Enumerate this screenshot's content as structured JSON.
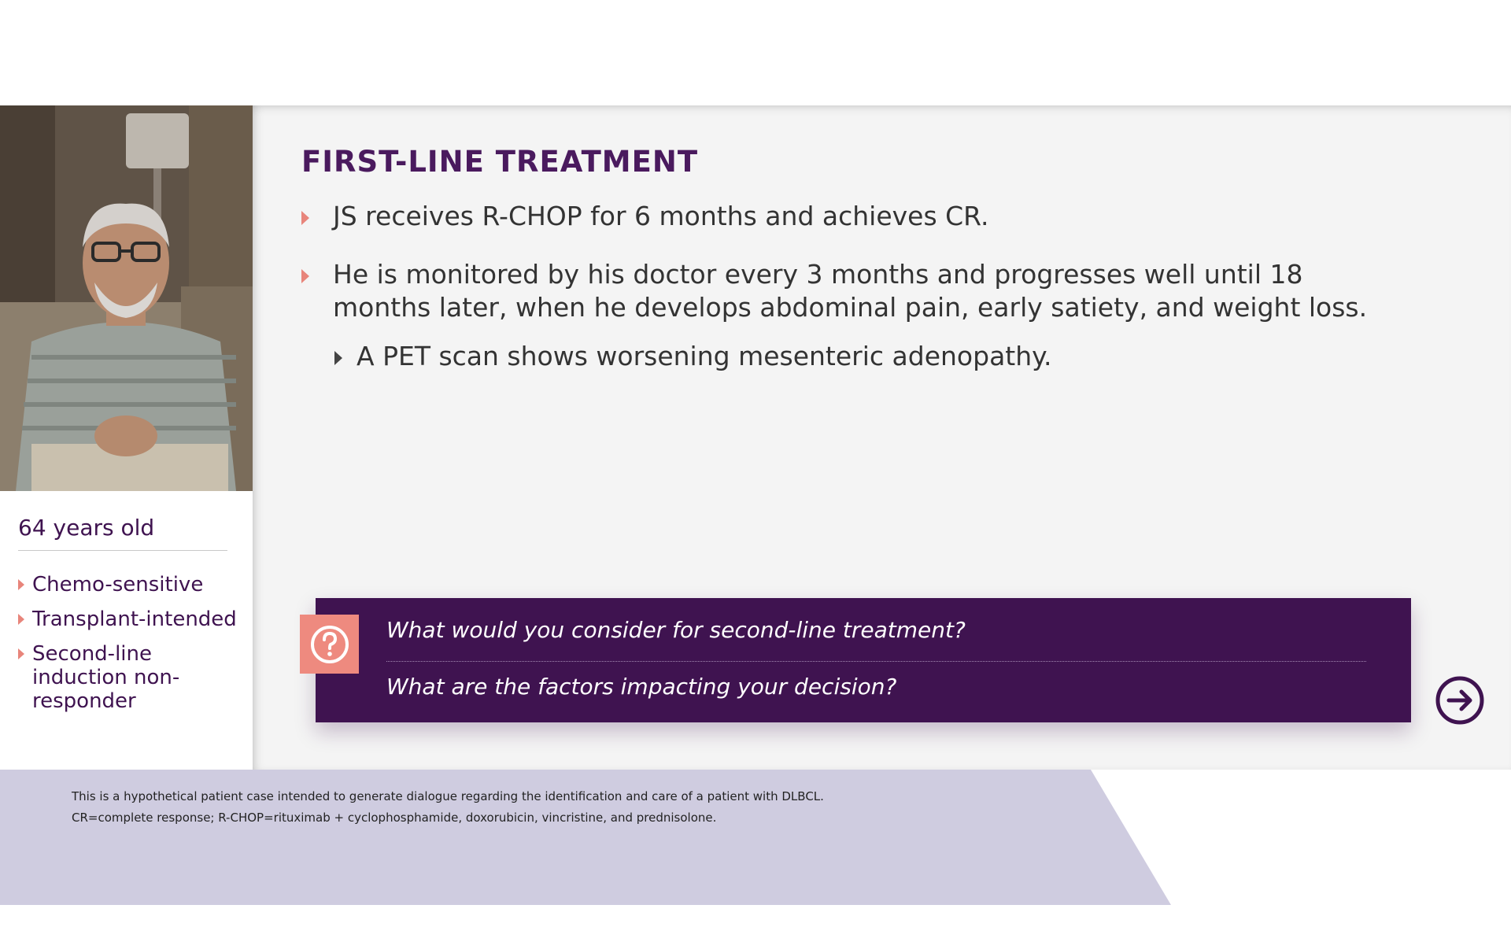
{
  "patient": {
    "photo_alt": "Patient JS portrait",
    "age": "64 years old",
    "attributes": [
      {
        "label": "Chemo-sensitive"
      },
      {
        "label": "Transplant-intended"
      },
      {
        "label": "Second-line induction non-responder"
      }
    ]
  },
  "main": {
    "title": "FIRST-LINE TREATMENT",
    "bullets": [
      "JS receives R-CHOP for 6 months and achieves CR.",
      "He is monitored by his doctor every 3 months and progresses well until 18 months later, when he develops abdominal pain, early satiety, and weight loss."
    ],
    "sub_bullet": "A PET scan shows worsening mesenteric adenopathy."
  },
  "questions": {
    "q1": "What would you consider for second-line treatment?",
    "q2": "What are the factors impacting your decision?",
    "icon": "question-mark-icon"
  },
  "navigation": {
    "next_icon": "arrow-right-circle-icon"
  },
  "footer": {
    "note1": "This is a hypothetical patient case intended to generate dialogue regarding the identification and care of a patient with DLBCL.",
    "note2": "CR=complete response; R-CHOP=rituximab + cyclophosphamide, doxorubicin, vincristine, and prednisolone."
  },
  "colors": {
    "brand_purple": "#3f1350",
    "title_purple": "#4a1a5e",
    "accent_coral": "#ee8a7f",
    "footer_lavender": "#cfcce0",
    "panel_gray": "#f4f4f4"
  }
}
